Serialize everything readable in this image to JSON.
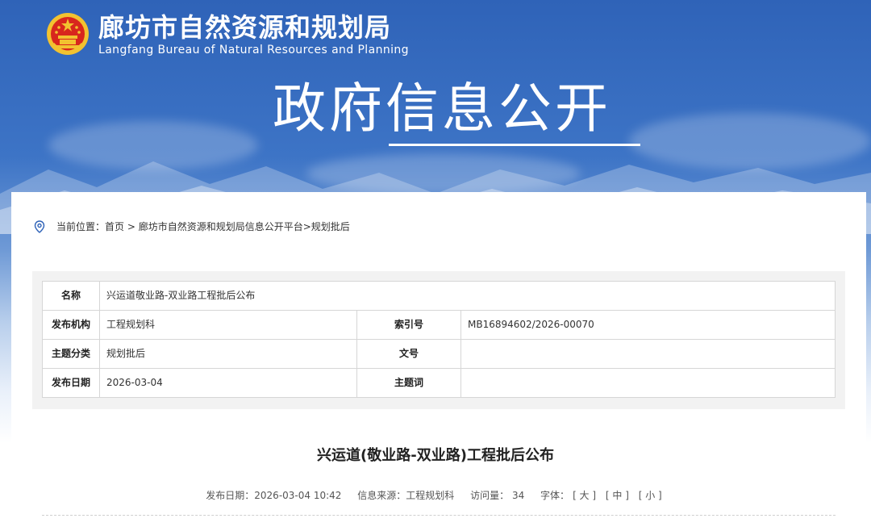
{
  "header": {
    "site_name_cn": "廊坊市自然资源和规划局",
    "site_name_en": "Langfang Bureau of Natural Resources and Planning",
    "emblem_icon": "national-emblem-icon",
    "hero_title": "政府信息公开",
    "colors": {
      "banner_top": "#2f63b8",
      "banner_mid": "#6f9ad6"
    }
  },
  "breadcrumb": {
    "icon": "location-pin-icon",
    "prefix": "当前位置：",
    "home": "首页",
    "sep1": " > ",
    "platform": "廊坊市自然资源和规划局信息公开平台",
    "sep2": ">",
    "current": "规划批后"
  },
  "meta_table": {
    "name_label": "名称",
    "name_value": "兴运道敬业路-双业路工程批后公布",
    "org_label": "发布机构",
    "org_value": "工程规划科",
    "index_label": "索引号",
    "index_value": "MB16894602/2026-00070",
    "topic_label": "主题分类",
    "topic_value": "规划批后",
    "docno_label": "文号",
    "docno_value": "",
    "date_label": "发布日期",
    "date_value": "2026-03-04",
    "keyword_label": "主题词",
    "keyword_value": ""
  },
  "article": {
    "title": "兴运道(敬业路-双业路)工程批后公布",
    "publish_date": "发布日期：2026-03-04 10:42",
    "source": "信息来源：工程规划科",
    "visits_label": "访问量：",
    "visits": "34",
    "font_label": "字体：",
    "font_large": "[ 大 ]",
    "font_medium": "[ 中 ]",
    "font_small": "[ 小 ]"
  }
}
